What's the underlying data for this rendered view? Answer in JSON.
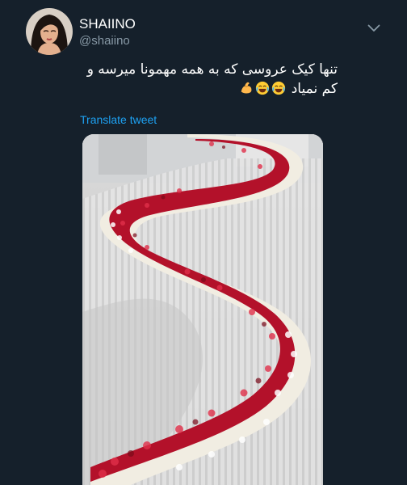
{
  "tweet": {
    "author": {
      "name": "SHAIINO",
      "handle": "@shaiino"
    },
    "text": "تنها کیک عروسی که به همه مهمونا میرسه و کم نمیاد",
    "emojis": [
      "laughing-face",
      "laughing-face",
      "flexed-biceps"
    ],
    "translate_label": "Translate tweet",
    "colors": {
      "background": "#15202b",
      "secondary_text": "#8899a6",
      "link": "#1da1f2",
      "strawberry": "#b3112a",
      "cream": "#f1ede2"
    }
  }
}
